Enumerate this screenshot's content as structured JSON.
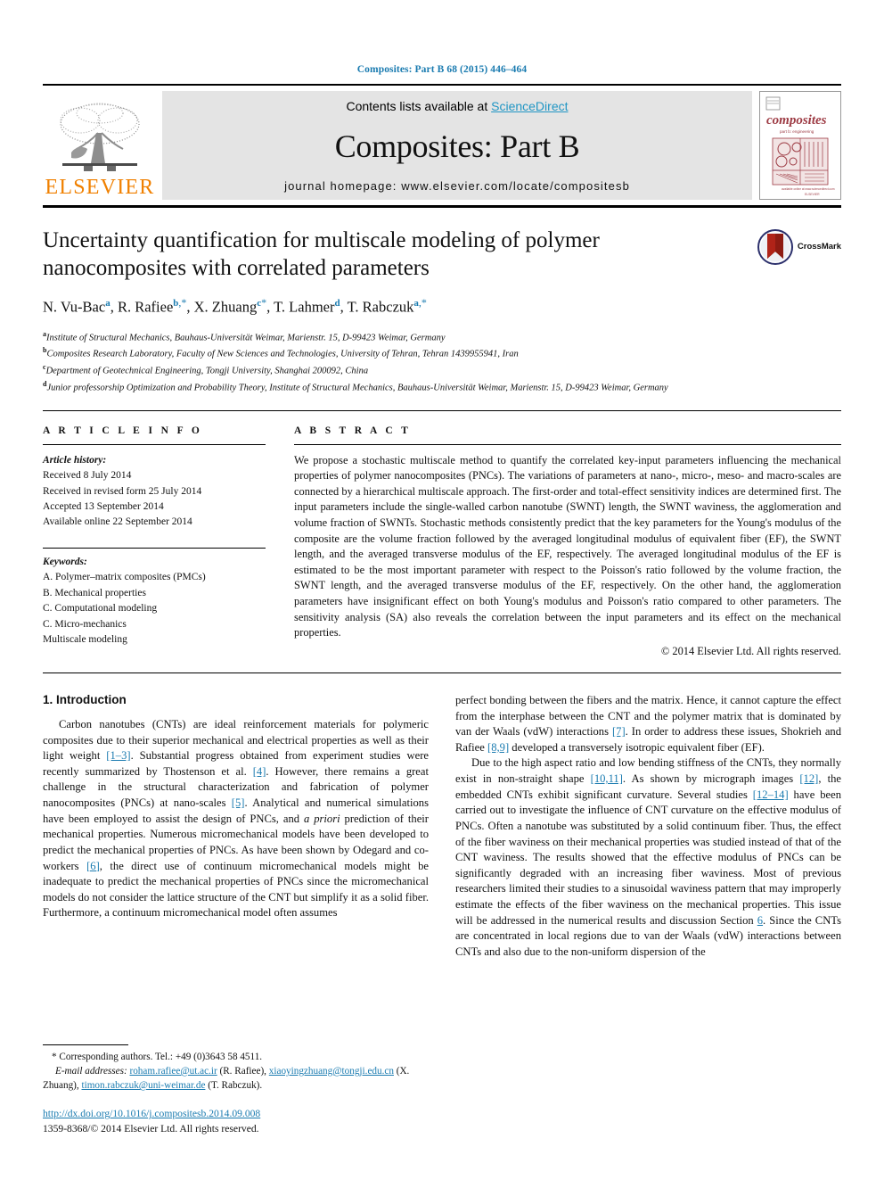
{
  "running_head": "Composites: Part B 68 (2015) 446–464",
  "masthead": {
    "contents_prefix": "Contents lists available at ",
    "sciencedirect": "ScienceDirect",
    "journal_title": "Composites: Part B",
    "homepage": "journal homepage: www.elsevier.com/locate/compositesb",
    "publisher": "ELSEVIER",
    "cover_title": "composites",
    "cover_subtitle": "engineering"
  },
  "article": {
    "title": "Uncertainty quantification for multiscale modeling of polymer nanocomposites with correlated parameters",
    "crossmark_label": "CrossMark",
    "authors": [
      {
        "name": "N. Vu-Bac",
        "sup": "a",
        "corr": ""
      },
      {
        "name": "R. Rafiee",
        "sup": "b",
        "corr": ",*"
      },
      {
        "name": "X. Zhuang",
        "sup": "c",
        "corr": "*"
      },
      {
        "name": "T. Lahmer",
        "sup": "d",
        "corr": ""
      },
      {
        "name": "T. Rabczuk",
        "sup": "a",
        "corr": ",*"
      }
    ],
    "affiliations": [
      {
        "mark": "a",
        "text": "Institute of Structural Mechanics, Bauhaus-Universität Weimar, Marienstr. 15, D-99423 Weimar, Germany"
      },
      {
        "mark": "b",
        "text": "Composites Research Laboratory, Faculty of New Sciences and Technologies, University of Tehran, Tehran 1439955941, Iran"
      },
      {
        "mark": "c",
        "text": "Department of Geotechnical Engineering, Tongji University, Shanghai 200092, China"
      },
      {
        "mark": "d",
        "text": "Junior professorship Optimization and Probability Theory, Institute of Structural Mechanics, Bauhaus-Universität Weimar, Marienstr. 15, D-99423 Weimar, Germany"
      }
    ]
  },
  "info": {
    "heading": "A R T I C L E   I N F O",
    "history_label": "Article history:",
    "history": [
      "Received 8 July 2014",
      "Received in revised form 25 July 2014",
      "Accepted 13 September 2014",
      "Available online 22 September 2014"
    ],
    "keywords_label": "Keywords:",
    "keywords": [
      "A. Polymer–matrix composites (PMCs)",
      "B. Mechanical properties",
      "C. Computational modeling",
      "C. Micro-mechanics",
      "Multiscale modeling"
    ]
  },
  "abstract": {
    "heading": "A B S T R A C T",
    "text": "We propose a stochastic multiscale method to quantify the correlated key-input parameters influencing the mechanical properties of polymer nanocomposites (PNCs). The variations of parameters at nano-, micro-, meso- and macro-scales are connected by a hierarchical multiscale approach. The first-order and total-effect sensitivity indices are determined first. The input parameters include the single-walled carbon nanotube (SWNT) length, the SWNT waviness, the agglomeration and volume fraction of SWNTs. Stochastic methods consistently predict that the key parameters for the Young's modulus of the composite are the volume fraction followed by the averaged longitudinal modulus of equivalent fiber (EF), the SWNT length, and the averaged transverse modulus of the EF, respectively. The averaged longitudinal modulus of the EF is estimated to be the most important parameter with respect to the Poisson's ratio followed by the volume fraction, the SWNT length, and the averaged transverse modulus of the EF, respectively. On the other hand, the agglomeration parameters have insignificant effect on both Young's modulus and Poisson's ratio compared to other parameters. The sensitivity analysis (SA) also reveals the correlation between the input parameters and its effect on the mechanical properties.",
    "copyright": "© 2014 Elsevier Ltd. All rights reserved."
  },
  "body": {
    "section_title": "1. Introduction",
    "left_paragraphs": [
      {
        "parts": [
          {
            "t": "Carbon nanotubes (CNTs) are ideal reinforcement materials for polymeric composites due to their superior mechanical and electrical properties as well as their light weight "
          },
          {
            "t": "[1–3]",
            "ref": true
          },
          {
            "t": ". Substantial progress obtained from experiment studies were recently summarized by Thostenson et al. "
          },
          {
            "t": "[4]",
            "ref": true
          },
          {
            "t": ". However, there remains a great challenge in the structural characterization and fabrication of polymer nanocomposites (PNCs) at nano-scales "
          },
          {
            "t": "[5]",
            "ref": true
          },
          {
            "t": ". Analytical and numerical simulations have been employed to assist the design of PNCs, and "
          },
          {
            "t": "a priori",
            "italic": true
          },
          {
            "t": " prediction of their mechanical properties. Numerous micromechanical models have been developed to predict the mechanical properties of PNCs. As have been shown by Odegard and co-workers "
          },
          {
            "t": "[6]",
            "ref": true
          },
          {
            "t": ", the direct use of continuum micromechanical models might be inadequate to predict the mechanical properties of PNCs since the micromechanical models do not consider the lattice structure of the CNT but simplify it as a solid fiber. Furthermore, a continuum micromechanical model often assumes"
          }
        ]
      }
    ],
    "right_paragraphs": [
      {
        "indent": false,
        "parts": [
          {
            "t": "perfect bonding between the fibers and the matrix. Hence, it cannot capture the effect from the interphase between the CNT and the polymer matrix that is dominated by van der Waals (vdW) interactions "
          },
          {
            "t": "[7]",
            "ref": true
          },
          {
            "t": ". In order to address these issues, Shokrieh and Rafiee "
          },
          {
            "t": "[8,9]",
            "ref": true
          },
          {
            "t": " developed a transversely isotropic equivalent fiber (EF)."
          }
        ]
      },
      {
        "indent": true,
        "parts": [
          {
            "t": "Due to the high aspect ratio and low bending stiffness of the CNTs, they normally exist in non-straight shape "
          },
          {
            "t": "[10,11]",
            "ref": true
          },
          {
            "t": ". As shown by micrograph images "
          },
          {
            "t": "[12]",
            "ref": true
          },
          {
            "t": ", the embedded CNTs exhibit significant curvature. Several studies "
          },
          {
            "t": "[12–14]",
            "ref": true
          },
          {
            "t": " have been carried out to investigate the influence of CNT curvature on the effective modulus of PNCs. Often a nanotube was substituted by a solid continuum fiber. Thus, the effect of the fiber waviness on their mechanical properties was studied instead of that of the CNT waviness. The results showed that the effective modulus of PNCs can be significantly degraded with an increasing fiber waviness. Most of previous researchers limited their studies to a sinusoidal waviness pattern that may improperly estimate the effects of the fiber waviness on the mechanical properties. This issue will be addressed in the numerical results and discussion Section "
          },
          {
            "t": "6",
            "ref": true
          },
          {
            "t": ". Since the CNTs are concentrated in local regions due to van der Waals (vdW) interactions between CNTs and also due to the non-uniform dispersion of the"
          }
        ]
      }
    ]
  },
  "footnotes": {
    "corresponding": "* Corresponding authors. Tel.: +49 (0)3643 58 4511.",
    "email_label": "E-mail addresses:",
    "emails": [
      {
        "address": "roham.rafiee@ut.ac.ir",
        "owner": " (R. Rafiee), "
      },
      {
        "address": "xiaoyingzhuang@tongji.edu.cn",
        "owner": " (X. Zhuang), "
      },
      {
        "address": "timon.rabczuk@uni-weimar.de",
        "owner": " (T. Rabczuk)."
      }
    ],
    "doi": "http://dx.doi.org/10.1016/j.compositesb.2014.09.008",
    "issn_line": "1359-8368/© 2014 Elsevier Ltd. All rights reserved."
  },
  "colors": {
    "link": "#1a7bb0",
    "elsevier_orange": "#f08000",
    "panel_gray": "#e4e4e4",
    "cover_maroon": "#9d3b44"
  }
}
